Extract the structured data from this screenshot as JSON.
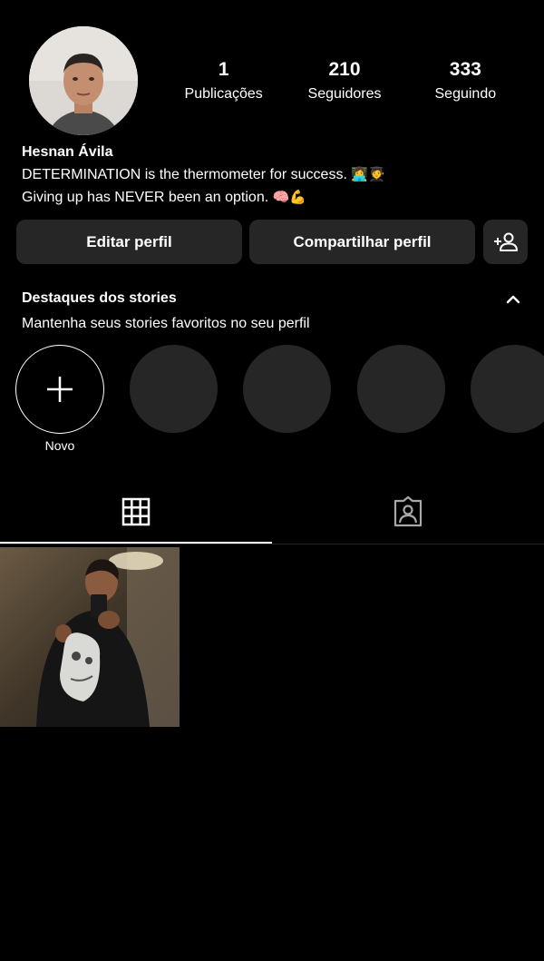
{
  "profile": {
    "name": "Hesnan Ávila",
    "bio_line1": "DETERMINATION is the thermometer for success.",
    "bio_line1_emoji": "👩‍💻🧑‍🎓",
    "bio_line2": "Giving up has NEVER been an option.",
    "bio_line2_emoji": "🧠💪"
  },
  "stats": [
    {
      "value": "1",
      "label": "Publicações"
    },
    {
      "value": "210",
      "label": "Seguidores"
    },
    {
      "value": "333",
      "label": "Seguindo"
    }
  ],
  "buttons": {
    "edit": "Editar perfil",
    "share": "Compartilhar perfil"
  },
  "highlights": {
    "title": "Destaques dos stories",
    "subtitle": "Mantenha seus stories favoritos no seu perfil",
    "new_label": "Novo",
    "placeholders": 4
  },
  "tabs": {
    "active": "grid",
    "items": [
      "grid-icon",
      "tagged-icon"
    ]
  },
  "posts": [
    {
      "description_icon": "mirror-selfie-photo"
    }
  ],
  "colors": {
    "background": "#000000",
    "surface": "#262626",
    "text": "#ffffff"
  }
}
